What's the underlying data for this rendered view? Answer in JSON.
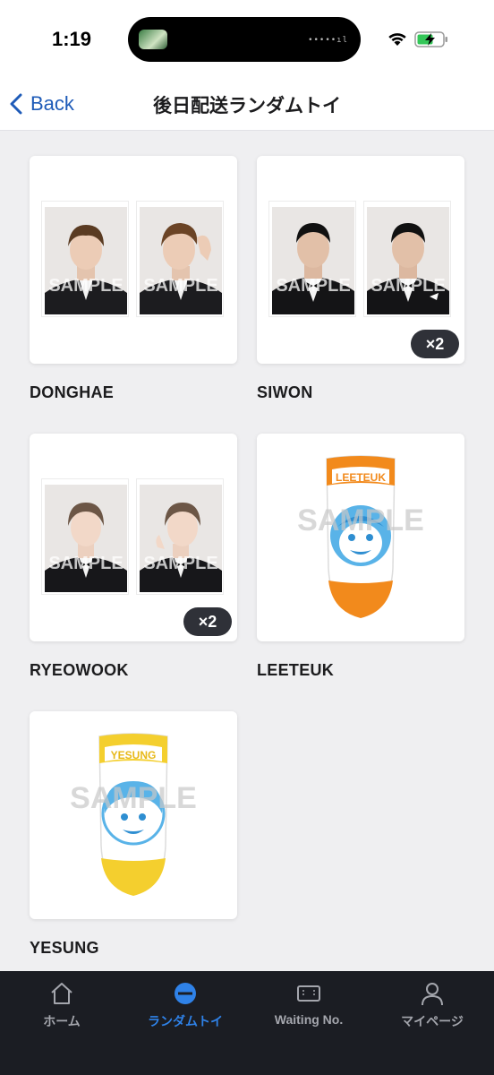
{
  "status_bar": {
    "time": "1:19",
    "island_dots": "•••••ıl"
  },
  "nav": {
    "back_label": "Back",
    "title": "後日配送ランダムトイ"
  },
  "items": [
    {
      "name": "DONGHAE",
      "type": "photo",
      "watermark": "SAMPLE",
      "count": ""
    },
    {
      "name": "SIWON",
      "type": "photo",
      "watermark": "SAMPLE",
      "count": "×2"
    },
    {
      "name": "RYEOWOOK",
      "type": "photo",
      "watermark": "SAMPLE",
      "count": "×2"
    },
    {
      "name": "LEETEUK",
      "type": "sock",
      "watermark": "SAMPLE",
      "sock_text": "LEETEUK",
      "accent": "#f28a1c",
      "count": ""
    },
    {
      "name": "YESUNG",
      "type": "sock",
      "watermark": "SAMPLE",
      "sock_text": "YESUNG",
      "accent": "#f4cf2e",
      "count": ""
    }
  ],
  "tab_bar": {
    "tabs": [
      {
        "label": "ホーム",
        "icon": "home-icon"
      },
      {
        "label": "ランダムトイ",
        "icon": "minus-circle-icon",
        "active": true
      },
      {
        "label": "Waiting No.",
        "icon": "ticket-icon"
      },
      {
        "label": "マイページ",
        "icon": "person-icon"
      }
    ]
  },
  "colors": {
    "accent_blue": "#2f82e8",
    "back_blue": "#1e5bb8",
    "tab_bar_bg": "#1b1d23",
    "badge_bg": "#2f3138"
  }
}
